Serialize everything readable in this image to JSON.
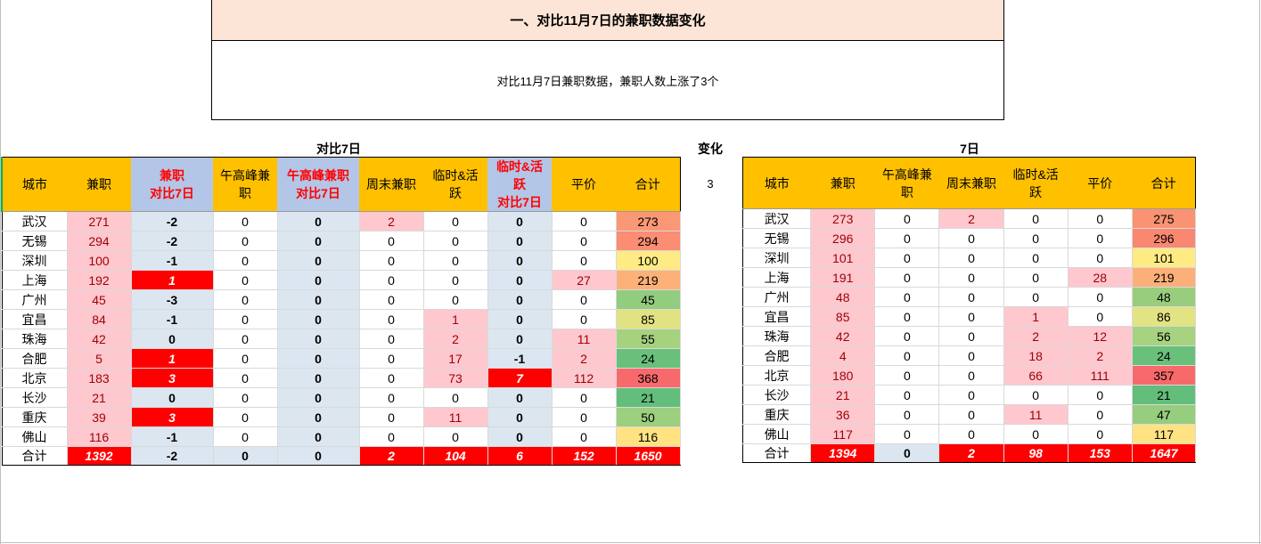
{
  "header": {
    "title": "一、对比11月7日的兼职数据变化",
    "summary": "对比11月7日兼职数据，兼职人数上涨了3个"
  },
  "left_table": {
    "section_label": "对比7日",
    "columns": [
      "城市",
      "兼职",
      "兼职\n对比7日",
      "午高峰兼\n职",
      "午高峰兼职\n对比7日",
      "周末兼职",
      "临时&活\n跃",
      "临时&活\n跃\n对比7日",
      "平价",
      "合计"
    ],
    "rows": [
      [
        "武汉",
        "271",
        "-2",
        "0",
        "0",
        "2",
        "0",
        "0",
        "0",
        "273"
      ],
      [
        "无锡",
        "294",
        "-2",
        "0",
        "0",
        "0",
        "0",
        "0",
        "0",
        "294"
      ],
      [
        "深圳",
        "100",
        "-1",
        "0",
        "0",
        "0",
        "0",
        "0",
        "0",
        "100"
      ],
      [
        "上海",
        "192",
        "1",
        "0",
        "0",
        "0",
        "0",
        "0",
        "27",
        "219"
      ],
      [
        "广州",
        "45",
        "-3",
        "0",
        "0",
        "0",
        "0",
        "0",
        "0",
        "45"
      ],
      [
        "宜昌",
        "84",
        "-1",
        "0",
        "0",
        "0",
        "1",
        "0",
        "0",
        "85"
      ],
      [
        "珠海",
        "42",
        "0",
        "0",
        "0",
        "0",
        "2",
        "0",
        "11",
        "55"
      ],
      [
        "合肥",
        "5",
        "1",
        "0",
        "0",
        "0",
        "17",
        "-1",
        "2",
        "24"
      ],
      [
        "北京",
        "183",
        "3",
        "0",
        "0",
        "0",
        "73",
        "7",
        "112",
        "368"
      ],
      [
        "长沙",
        "21",
        "0",
        "0",
        "0",
        "0",
        "0",
        "0",
        "0",
        "21"
      ],
      [
        "重庆",
        "39",
        "3",
        "0",
        "0",
        "0",
        "11",
        "0",
        "0",
        "50"
      ],
      [
        "佛山",
        "116",
        "-1",
        "0",
        "0",
        "0",
        "0",
        "0",
        "0",
        "116"
      ]
    ],
    "total": [
      "合计",
      "1392",
      "-2",
      "0",
      "0",
      "2",
      "104",
      "6",
      "152",
      "1650"
    ]
  },
  "change": {
    "label": "变化",
    "value": "3"
  },
  "right_table": {
    "section_label": "7日",
    "columns": [
      "城市",
      "兼职",
      "午高峰兼\n职",
      "周末兼职",
      "临时&活\n跃",
      "平价",
      "合计"
    ],
    "rows": [
      [
        "武汉",
        "273",
        "0",
        "2",
        "0",
        "0",
        "275"
      ],
      [
        "无锡",
        "296",
        "0",
        "0",
        "0",
        "0",
        "296"
      ],
      [
        "深圳",
        "101",
        "0",
        "0",
        "0",
        "0",
        "101"
      ],
      [
        "上海",
        "191",
        "0",
        "0",
        "0",
        "28",
        "219"
      ],
      [
        "广州",
        "48",
        "0",
        "0",
        "0",
        "0",
        "48"
      ],
      [
        "宜昌",
        "85",
        "0",
        "0",
        "1",
        "0",
        "86"
      ],
      [
        "珠海",
        "42",
        "0",
        "0",
        "2",
        "12",
        "56"
      ],
      [
        "合肥",
        "4",
        "0",
        "0",
        "18",
        "2",
        "24"
      ],
      [
        "北京",
        "180",
        "0",
        "0",
        "66",
        "111",
        "357"
      ],
      [
        "长沙",
        "21",
        "0",
        "0",
        "0",
        "0",
        "21"
      ],
      [
        "重庆",
        "36",
        "0",
        "0",
        "11",
        "0",
        "47"
      ],
      [
        "佛山",
        "117",
        "0",
        "0",
        "0",
        "0",
        "117"
      ]
    ],
    "total": [
      "合计",
      "1394",
      "0",
      "2",
      "98",
      "153",
      "1647"
    ]
  },
  "colors": {
    "header_fill": "#ffc000",
    "title_fill": "#fce4d6",
    "compare_header_fill": "#b4c6e7",
    "compare_fill": "#dce6f1",
    "pink_fill": "#ffc7ce",
    "pink_text": "#9c0006",
    "red_fill": "#ff0000",
    "scale_low": "#63be7b",
    "scale_mid": "#ffeb84",
    "scale_high": "#f8696b"
  }
}
